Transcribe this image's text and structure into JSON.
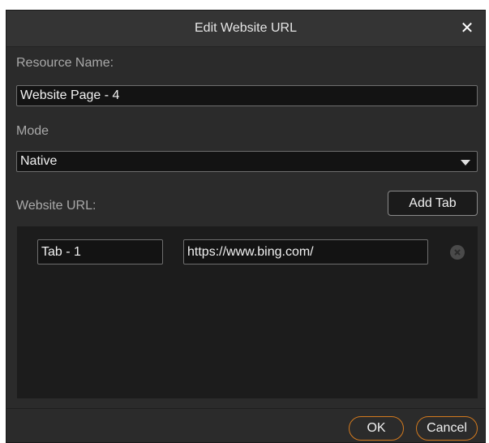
{
  "dialog": {
    "title": "Edit Website URL",
    "close_glyph": "✕"
  },
  "resource": {
    "label": "Resource Name:",
    "value": "Website Page - 4"
  },
  "mode": {
    "label": "Mode",
    "selected": "Native"
  },
  "website": {
    "label": "Website URL:",
    "add_tab_label": "Add Tab",
    "tabs": [
      {
        "name": "Tab - 1",
        "url": "https://www.bing.com/"
      }
    ]
  },
  "footer": {
    "ok_label": "OK",
    "cancel_label": "Cancel"
  },
  "colors": {
    "dialog_bg": "#2b2b2b",
    "panel_bg": "#1c1c1c",
    "field_bg": "#131313",
    "accent": "#d37a1e"
  },
  "icons": [
    "close-icon",
    "dropdown-arrow-icon",
    "remove-tab-icon"
  ]
}
